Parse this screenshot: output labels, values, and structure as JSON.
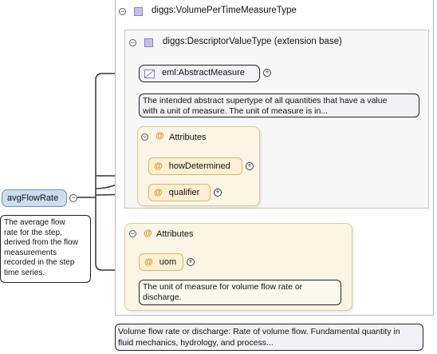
{
  "root_element": {
    "name": "avgFlowRate",
    "documentation": [
      "The average flow",
      "rate for the step,",
      "derived from the flow",
      "measurements",
      "recorded in the step",
      "time series."
    ]
  },
  "type": {
    "name": "diggs:VolumePerTimeMeasureType",
    "documentation": [
      "Volume flow rate or discharge: Rate of volume flow. Fundamental quantity in",
      "fluid mechanics, hydrology, and process..."
    ]
  },
  "base_type": {
    "name": "diggs:DescriptorValueType (extension base)"
  },
  "abstract_measure": {
    "name": "eml:AbstractMeasure",
    "documentation": [
      "The intended abstract supertype of all quantities that have a value",
      "with a unit of measure. The unit of measure is in..."
    ]
  },
  "base_attributes": {
    "label": "Attributes",
    "items": [
      "howDetermined",
      "qualifier"
    ]
  },
  "type_attributes": {
    "label": "Attributes",
    "uom": {
      "name": "uom",
      "documentation": [
        "The unit of measure for volume flow rate or",
        "discharge."
      ]
    }
  },
  "symbols": {
    "collapse": "⊖",
    "expand": "+",
    "attribute_marker": "@"
  }
}
